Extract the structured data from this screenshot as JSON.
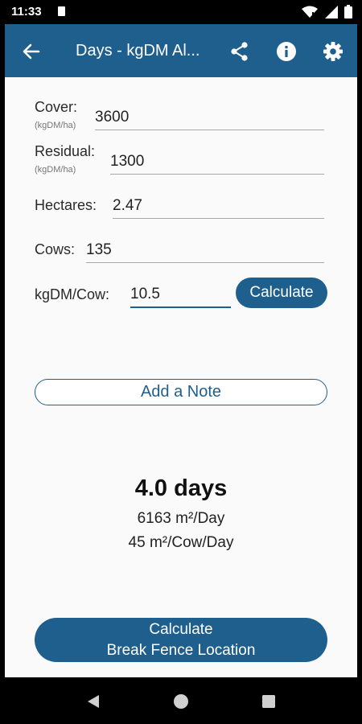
{
  "status_bar": {
    "time": "11:33",
    "icons": [
      "sim-card-icon",
      "wifi-icon",
      "signal-icon",
      "battery-icon"
    ]
  },
  "app_bar": {
    "title": "Days - kgDM Al...",
    "back_icon": "arrow-left-icon",
    "actions": [
      "share-icon",
      "info-icon",
      "settings-gear-icon"
    ],
    "color": "#1f5f8d"
  },
  "form": {
    "cover": {
      "label": "Cover:",
      "unit": "(kgDM/ha)",
      "value": "3600"
    },
    "residual": {
      "label": "Residual:",
      "unit": "(kgDM/ha)",
      "value": "1300"
    },
    "hectares": {
      "label": "Hectares:",
      "value": "2.47"
    },
    "cows": {
      "label": "Cows:",
      "value": "135"
    },
    "kgdm_cow": {
      "label": "kgDM/Cow:",
      "value": "10.5"
    },
    "calculate_label": "Calculate"
  },
  "note_button_label": "Add a Note",
  "results": {
    "days": "4.0 days",
    "area_per_day": "6163 m²/Day",
    "area_per_cow_day": "45 m²/Cow/Day"
  },
  "break_fence": {
    "line1": "Calculate",
    "line2": "Break Fence Location"
  },
  "nav_bar": {
    "icons": [
      "back-triangle-icon",
      "home-circle-icon",
      "recents-square-icon"
    ]
  }
}
